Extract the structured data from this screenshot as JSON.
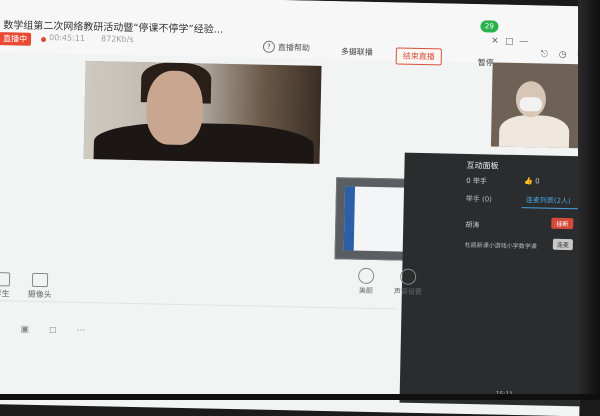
{
  "window": {
    "title": "数学组第二次网络教研活动暨“停课不停学”经验...",
    "live_badge": "直播中",
    "elapsed": "00:45:11",
    "rate": "872Kb/s",
    "help_label": "直播帮助",
    "multi_camera_label": "多摄联播",
    "end_live_label": "结束直播",
    "pause_label": "暂停",
    "notif_count": "29",
    "controls": [
      "✕",
      "□",
      "—"
    ]
  },
  "panel": {
    "title": "互动面板",
    "hands_label": "0 举手",
    "likes_label": "0",
    "tab_left": "举手 (0)",
    "tab_right": "连麦列表(2人)",
    "row1_text": "胡涛",
    "row1_button": "挂断",
    "row2_text": "杜鹃新课小游戏小学数学课",
    "row2_button": "连麦"
  },
  "toolbar": {
    "left_items": [
      "学生",
      "摄像头"
    ],
    "right_items": [
      "美颜",
      "声音设置"
    ]
  },
  "taskbar": {
    "time": "15:11"
  },
  "colors": {
    "accent_red": "#e84a33",
    "accent_blue": "#4aa3e0",
    "panel_bg": "#2b2c2e"
  }
}
